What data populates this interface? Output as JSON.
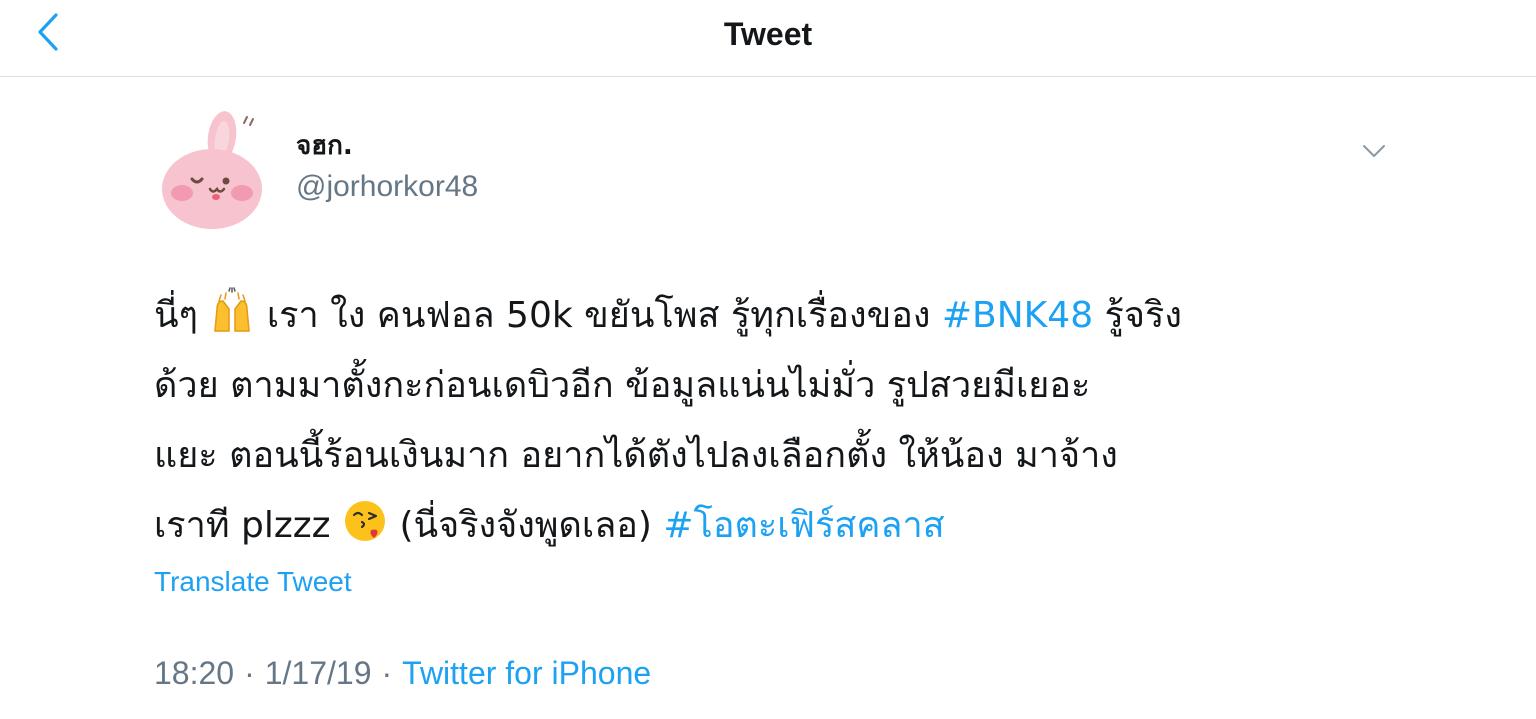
{
  "navbar": {
    "title": "Tweet",
    "back_icon": "chevron-left-icon"
  },
  "author": {
    "display_name": "จฮก.",
    "handle": "@jorhorkor48",
    "avatar_icon": "pink-bunny-avatar"
  },
  "tweet": {
    "lines": [
      [
        "นี่ๆ ",
        {
          "emoji": "raising-hands"
        },
        " เรา ใง คนฟอล 50k ขยันโพส รู้ทุกเรื่องของ ",
        {
          "hashtag": "#BNK48"
        },
        " รู้จริง"
      ],
      [
        "ด้วย ตามมาตั้งกะก่อนเดบิวอีก ข้อมูลแน่นไม่มั่ว รูปสวยมีเยอะ"
      ],
      [
        "แยะ ตอนนี้ร้อนเงินมาก อยากได้ตังไปลงเลือกตั้ง ให้น้อง มาจ้าง"
      ],
      [
        "เราที plzzz ",
        {
          "emoji": "face-blowing-kiss"
        },
        " (นี่จริงจังพูดเลอ) ",
        {
          "hashtag": "#โอตะเฟิร์สคลาส"
        }
      ]
    ],
    "translate_label": "Translate Tweet",
    "time": "18:20",
    "date": "1/17/19",
    "separator": "·",
    "source": "Twitter for iPhone"
  },
  "colors": {
    "accent": "#1da1f2",
    "text": "#14171a",
    "secondary": "#657786",
    "divider": "#dadfe3"
  }
}
